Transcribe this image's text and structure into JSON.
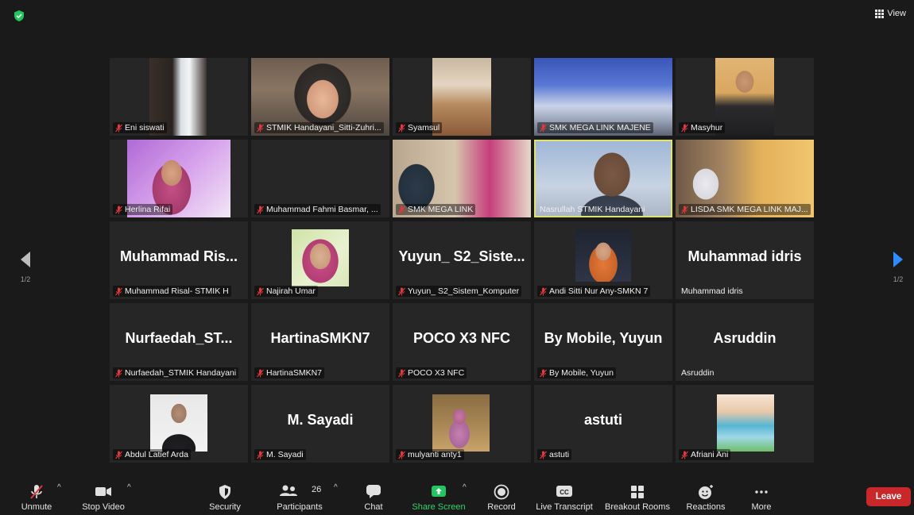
{
  "header": {
    "view_label": "View"
  },
  "pager": {
    "left": "1/2",
    "right": "1/2"
  },
  "tiles": [
    {
      "name": "Eni siswati",
      "muted": true,
      "big": ""
    },
    {
      "name": "STMIK Handayani_Sitti-Zuhri...",
      "muted": true,
      "big": ""
    },
    {
      "name": "Syamsul",
      "muted": true,
      "big": ""
    },
    {
      "name": "SMK MEGA LINK MAJENE",
      "muted": true,
      "big": ""
    },
    {
      "name": "Masyhur",
      "muted": true,
      "big": ""
    },
    {
      "name": "Herlina Rifai",
      "muted": true,
      "big": ""
    },
    {
      "name": "Muhammad Fahmi Basmar, ...",
      "muted": true,
      "big": ""
    },
    {
      "name": "SMK MEGA LINK",
      "muted": true,
      "big": ""
    },
    {
      "name": "Nasrullah STMIK Handayani",
      "muted": false,
      "big": ""
    },
    {
      "name": "LISDA SMK MEGA LINK MAJ...",
      "muted": true,
      "big": ""
    },
    {
      "name": "Muhammad Risal- STMIK H",
      "muted": true,
      "big": "Muhammad  Ris..."
    },
    {
      "name": "Najirah Umar",
      "muted": true,
      "big": ""
    },
    {
      "name": "Yuyun_ S2_Sistem_Komputer",
      "muted": true,
      "big": "Yuyun_ S2_Siste..."
    },
    {
      "name": "Andi Sitti Nur Any-SMKN 7",
      "muted": true,
      "big": ""
    },
    {
      "name": "Muhammad idris",
      "muted": false,
      "big": "Muhammad idris"
    },
    {
      "name": "Nurfaedah_STMIK Handayani",
      "muted": true,
      "big": "Nurfaedah_ST..."
    },
    {
      "name": "HartinaSMKN7",
      "muted": true,
      "big": "HartinaSMKN7"
    },
    {
      "name": "POCO X3 NFC",
      "muted": true,
      "big": "POCO X3 NFC"
    },
    {
      "name": "By Mobile, Yuyun",
      "muted": true,
      "big": "By Mobile, Yuyun"
    },
    {
      "name": "Asruddin",
      "muted": false,
      "big": "Asruddin"
    },
    {
      "name": "Abdul Latief Arda",
      "muted": true,
      "big": ""
    },
    {
      "name": "M. Sayadi",
      "muted": true,
      "big": "M. Sayadi"
    },
    {
      "name": "mulyanti anty1",
      "muted": true,
      "big": ""
    },
    {
      "name": "astuti",
      "muted": true,
      "big": "astuti"
    },
    {
      "name": "Afriani Ani",
      "muted": true,
      "big": ""
    }
  ],
  "toolbar": {
    "unmute": "Unmute",
    "stop_video": "Stop Video",
    "security": "Security",
    "participants": "Participants",
    "participants_count": "26",
    "chat": "Chat",
    "share_screen": "Share Screen",
    "record": "Record",
    "live_transcript": "Live Transcript",
    "breakout_rooms": "Breakout Rooms",
    "reactions": "Reactions",
    "more": "More",
    "leave": "Leave"
  },
  "colors": {
    "accent_green": "#22c55e",
    "leave_red": "#c8282a",
    "active_border": "#dfe36d",
    "mute_red": "#e0393e"
  }
}
